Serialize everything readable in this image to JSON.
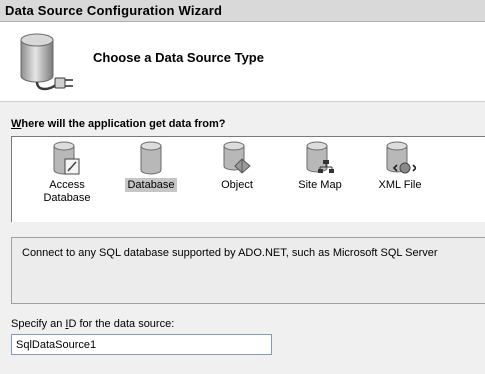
{
  "window": {
    "title": "Data Source Configuration Wizard"
  },
  "header": {
    "title": "Choose a Data Source Type",
    "icon": "database-plug-icon"
  },
  "question": {
    "access_key": "W",
    "rest": "here will the application get data from?"
  },
  "types": [
    {
      "label_line1": "Access",
      "label_line2": "Database",
      "icon": "access-database-icon",
      "selected": false
    },
    {
      "label_line1": "Database",
      "label_line2": "",
      "icon": "database-icon",
      "selected": true
    },
    {
      "label_line1": "Object",
      "label_line2": "",
      "icon": "object-icon",
      "selected": false
    },
    {
      "label_line1": "Site Map",
      "label_line2": "",
      "icon": "site-map-icon",
      "selected": false
    },
    {
      "label_line1": "XML File",
      "label_line2": "",
      "icon": "xml-file-icon",
      "selected": false
    }
  ],
  "description": "Connect to any SQL database supported by ADO.NET, such as Microsoft SQL Server",
  "id_field": {
    "label_before": "Specify an ",
    "label_access_key": "I",
    "label_after": "D for the data source:",
    "value": "SqlDataSource1"
  },
  "colors": {
    "selection": "#c6c6c6",
    "input_border": "#7f9db9",
    "panel_bg": "#f0f0f0"
  }
}
